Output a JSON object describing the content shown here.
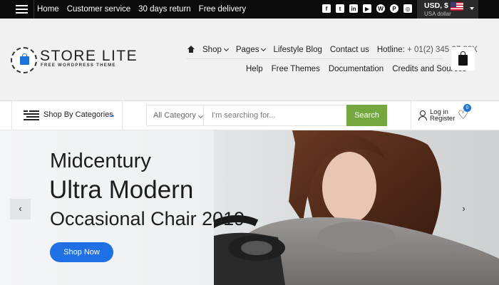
{
  "topbar": {
    "links": [
      "Home",
      "Customer service",
      "30 days return",
      "Free delivery"
    ],
    "social_icons": [
      "facebook-icon",
      "twitter-icon",
      "linkedin-icon",
      "youtube-icon",
      "wordpress-icon",
      "pinterest-icon",
      "instagram-icon"
    ],
    "currency": {
      "code": "USD, $",
      "name": "USA dollar"
    }
  },
  "logo": {
    "title": "STORE LITE",
    "subtitle": "FREE WORDPRESS THEME"
  },
  "nav": {
    "primary": [
      "Shop",
      "Pages",
      "Lifestyle Blog",
      "Contact us"
    ],
    "hotline_label": "Hotline:",
    "hotline_number": "+ 01(2) 345 67 89X",
    "secondary": [
      "Help",
      "Free Themes",
      "Documentation",
      "Credits and Sources"
    ]
  },
  "search": {
    "categories_label": "Shop By Categories",
    "category_select": "All Category",
    "placeholder": "I'm searching for...",
    "button": "Search"
  },
  "account": {
    "login": "Log in",
    "register": "Register",
    "wishlist_count": "0"
  },
  "hero": {
    "line1": "Midcentury",
    "line2": "Ultra Modern",
    "line3": "Occasional Chair 2019",
    "button": "Shop Now"
  },
  "colors": {
    "accent_blue": "#1f6fe5",
    "search_green": "#74a83f",
    "topbar": "#0b0b0b"
  }
}
